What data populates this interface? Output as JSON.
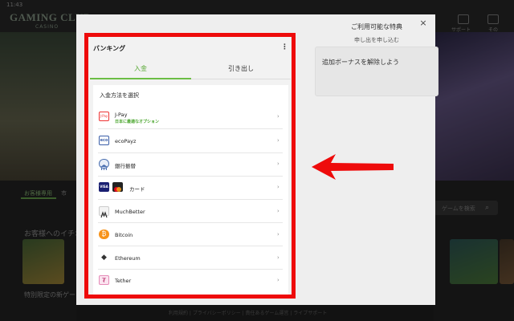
{
  "status": {
    "time": "11:43"
  },
  "site": {
    "logo": "GAMING CLUB",
    "logo_sub": "CASINO",
    "top_nav": [
      "サポート",
      "その"
    ],
    "left_tab": "お客様専用",
    "left_tab_suffix": "市",
    "search_placeholder": "ゲームを検索",
    "section_title": "お客様へのイチオ",
    "section_title_2": "特別限定の新ゲー",
    "footer": "利用規約 | プライバシーポリシー | 責任あるゲーム運営 | ライブサポート"
  },
  "modal": {
    "close_label": "×",
    "bonus": {
      "title": "ご利用可能な特典",
      "subtitle": "申し出を申し込む",
      "card_text": "追加ボーナスを解除しよう"
    },
    "banking": {
      "title": "バンキング",
      "menu_glyph": "⋮",
      "tabs": [
        {
          "label": "入金",
          "active": true
        },
        {
          "label": "引き出し",
          "active": false
        }
      ],
      "list_heading": "入金方法を選択",
      "methods": [
        {
          "name": "J-Pay",
          "badge": "日本に最適なオプション",
          "icon": "jpay-icon"
        },
        {
          "name": "ecoPayz",
          "badge": "",
          "icon": "ecopayz-icon"
        },
        {
          "name": "銀行振替",
          "badge": "",
          "icon": "bank-transfer-icon"
        },
        {
          "name": "カード",
          "badge": "",
          "icon": "visa-mastercard-icon"
        },
        {
          "name": "MuchBetter",
          "badge": "",
          "icon": "muchbetter-icon"
        },
        {
          "name": "Bitcoin",
          "badge": "",
          "icon": "bitcoin-icon"
        },
        {
          "name": "Ethereum",
          "badge": "",
          "icon": "ethereum-icon"
        },
        {
          "name": "Tether",
          "badge": "",
          "icon": "tether-icon"
        }
      ],
      "chevron": "›"
    }
  },
  "icon_text": {
    "jpay": "J-Pay",
    "eco": "eco",
    "visa": "VISA",
    "bitcoin": "₿",
    "ethereum": "◆",
    "tether": "₮"
  },
  "colors": {
    "accent_green": "#6cbe45",
    "highlight_red": "#ee0b0b",
    "badge_green": "#49a52c"
  }
}
